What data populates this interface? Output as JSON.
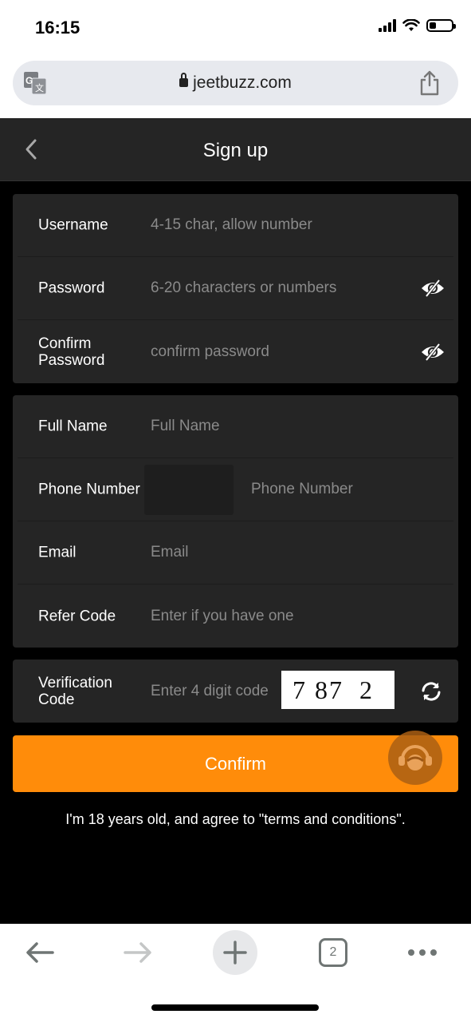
{
  "status_bar": {
    "time": "16:15",
    "battery_level": 0.25
  },
  "browser": {
    "url": "jeetbuzz.com",
    "translate_icon": "google-translate-icon",
    "share_icon": "share-icon",
    "toolbar": {
      "back_icon": "arrow-left-icon",
      "forward_icon": "arrow-right-icon",
      "new_tab_icon": "plus-icon",
      "tab_count": "2",
      "more_icon": "ellipsis-icon"
    }
  },
  "header": {
    "title": "Sign up",
    "back_icon": "chevron-left-icon"
  },
  "account_section": [
    {
      "label": "Username",
      "placeholder": "4-15 char, allow number",
      "has_eye": false
    },
    {
      "label": "Password",
      "placeholder": "6-20 characters or numbers",
      "has_eye": true
    },
    {
      "label": "Confirm Password",
      "placeholder": "confirm password",
      "has_eye": true
    }
  ],
  "profile_section": [
    {
      "label": "Full Name",
      "placeholder": "Full Name"
    },
    {
      "label": "Phone Number",
      "placeholder": "Phone Number",
      "country_code": ""
    },
    {
      "label": "Email",
      "placeholder": "Email"
    },
    {
      "label": "Refer Code",
      "placeholder": "Enter if you have one"
    }
  ],
  "verification": {
    "label": "Verification Code",
    "placeholder": "Enter 4 digit code",
    "captcha": "7 87  2",
    "refresh_icon": "refresh-icon"
  },
  "confirm_button": "Confirm",
  "support_icon": "customer-support-icon",
  "terms_text": "I'm 18 years old, and agree to \"terms and conditions\".",
  "colors": {
    "accent": "#ff8c0a",
    "card_bg": "#252525",
    "page_bg": "#000000"
  }
}
